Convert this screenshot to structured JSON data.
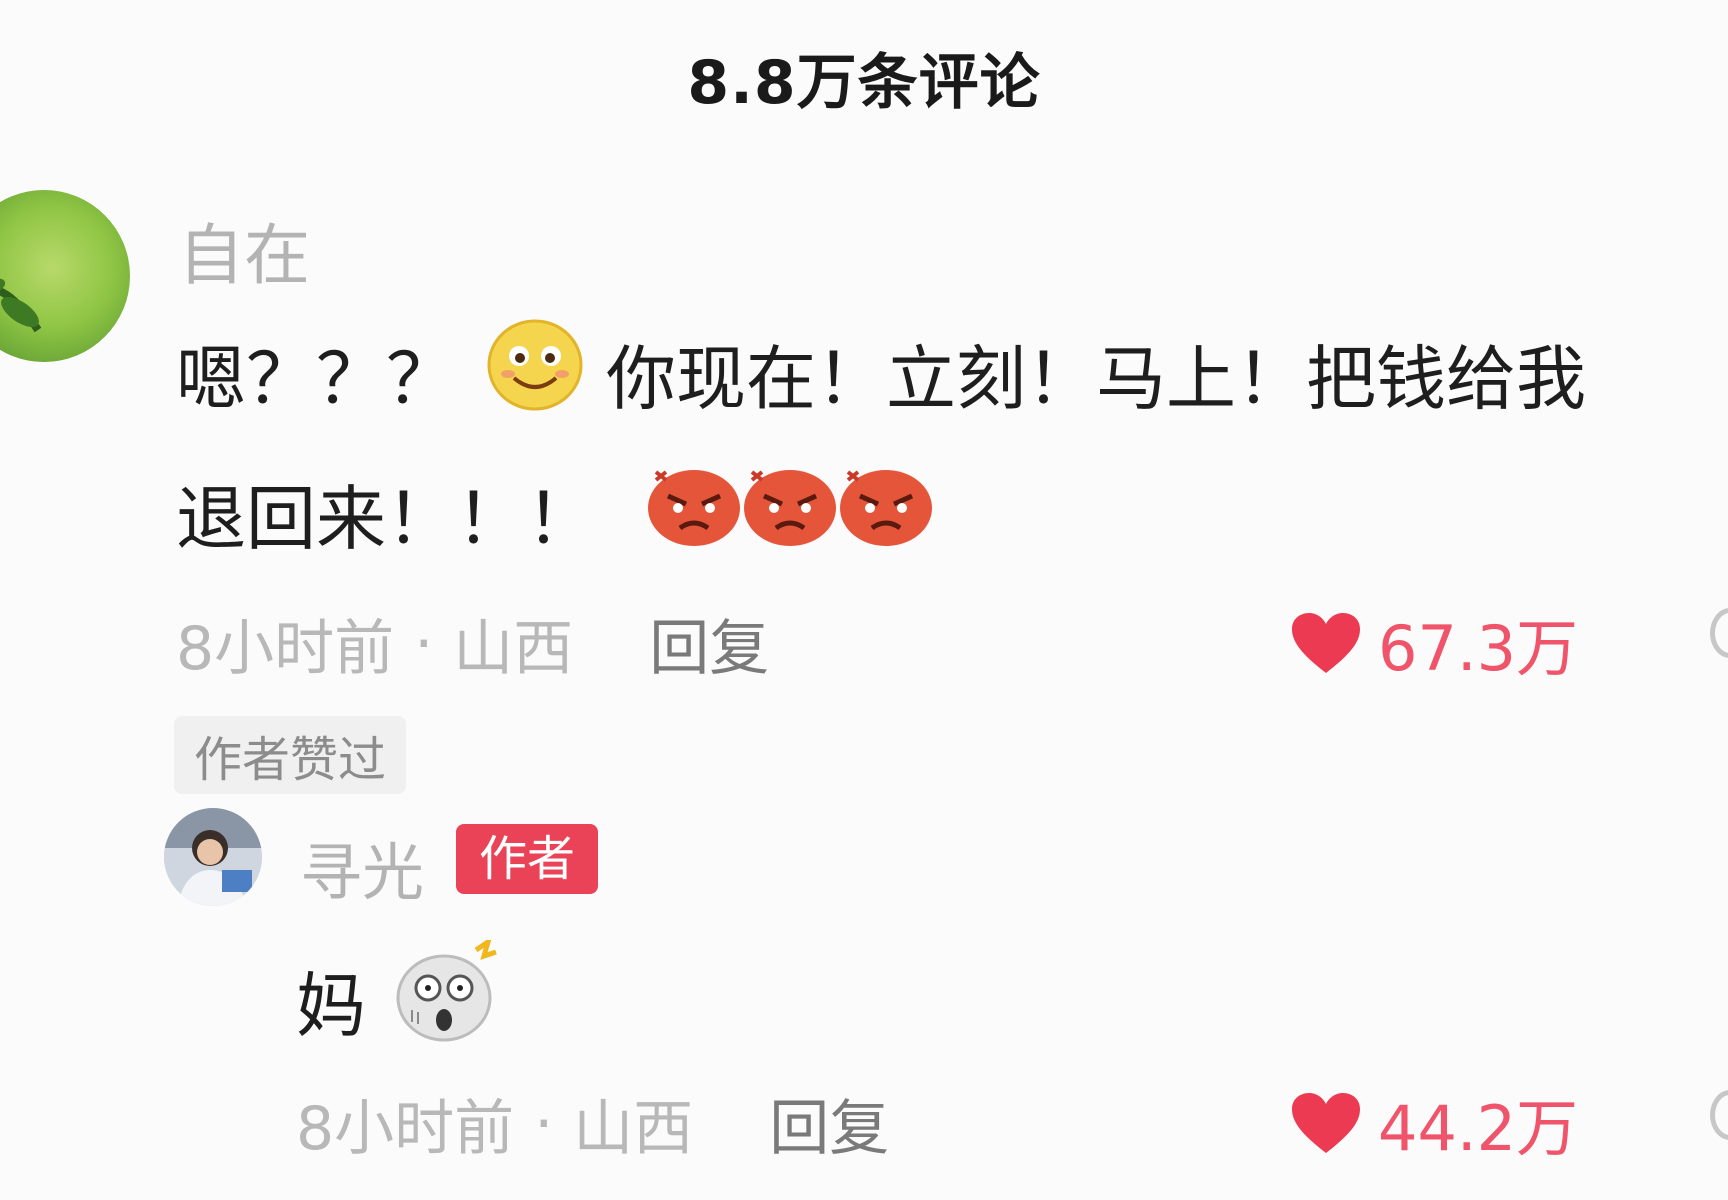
{
  "header": {
    "title": "8.8万条评论"
  },
  "comment": {
    "username": "自在",
    "text_part1": "嗯？？？",
    "text_part2": "你现在！立刻！马上！把钱给我",
    "text_part3": "退回来！！！",
    "emojis": [
      "smile-emoji",
      "angry-emoji",
      "angry-emoji",
      "angry-emoji"
    ],
    "time": "8小时前",
    "separator": "·",
    "location": "山西",
    "reply_label": "回复",
    "likes": "67.3万",
    "author_liked_label": "作者赞过"
  },
  "reply": {
    "username": "寻光",
    "author_tag": "作者",
    "text": "妈",
    "emojis": [
      "shocked-emoji"
    ],
    "time": "8小时前",
    "separator": "·",
    "location": "山西",
    "reply_label": "回复",
    "likes": "44.2万"
  },
  "colors": {
    "like": "#f0546a",
    "author_tag": "#ea4358",
    "muted_text": "#b8b8b8"
  },
  "icons": [
    "heart-icon",
    "comment-bubble-icon"
  ]
}
